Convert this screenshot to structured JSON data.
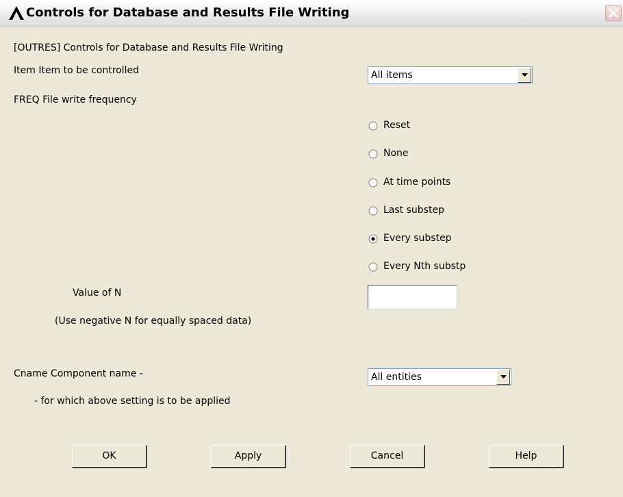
{
  "window": {
    "title": "Controls for Database and Results File Writing",
    "close_icon": "close-icon"
  },
  "header": "[OUTRES]  Controls for Database and Results File Writing",
  "item": {
    "label": "Item   Item to be controlled",
    "value": "All items"
  },
  "freq": {
    "label": "FREQ   File write frequency",
    "options": [
      {
        "label": "Reset",
        "selected": false
      },
      {
        "label": "None",
        "selected": false
      },
      {
        "label": "At time points",
        "selected": false
      },
      {
        "label": "Last substep",
        "selected": false
      },
      {
        "label": "Every substep",
        "selected": true
      },
      {
        "label": "Every Nth substp",
        "selected": false
      }
    ]
  },
  "value_n": {
    "label": "Value of N",
    "hint": "(Use negative N for equally spaced data)",
    "value": ""
  },
  "cname": {
    "label": "Cname  Component name -",
    "sublabel": "- for which above setting is to be applied",
    "value": "All entities"
  },
  "buttons": {
    "ok": "OK",
    "apply": "Apply",
    "cancel": "Cancel",
    "help": "Help"
  },
  "colors": {
    "dialog_bg": "#ece9d8",
    "close_button": "#e3c3c3"
  }
}
